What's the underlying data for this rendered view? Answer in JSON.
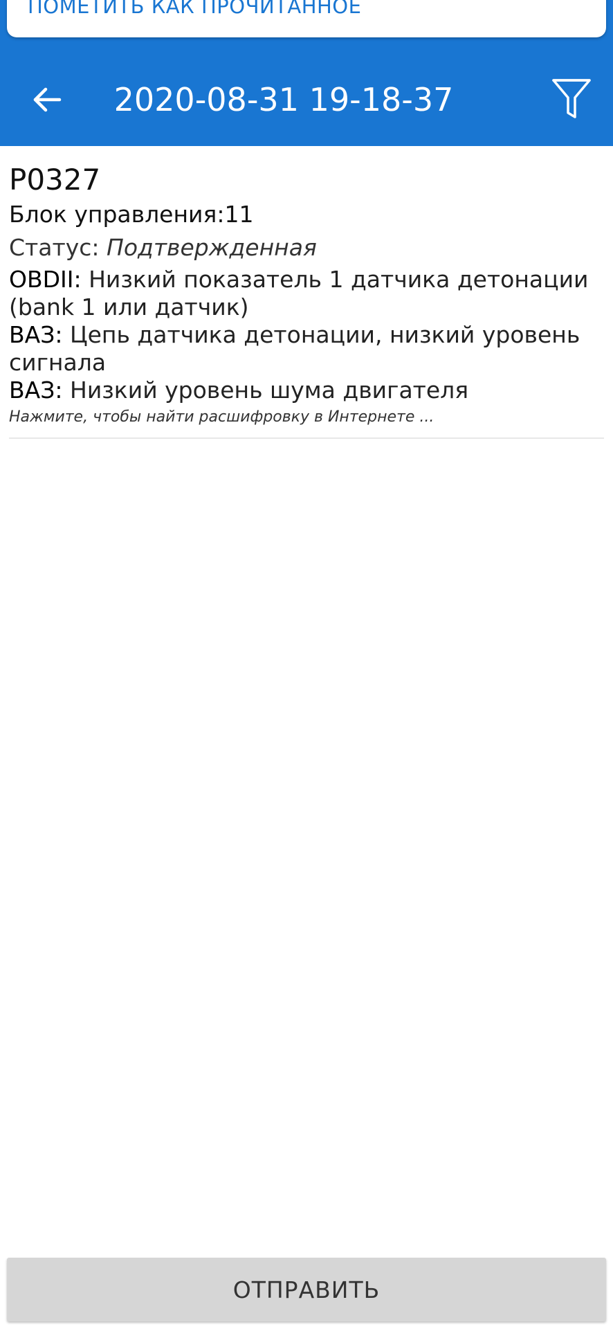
{
  "mark_read": {
    "label": "ПОМЕТИТЬ КАК ПРОЧИТАННОЕ"
  },
  "header": {
    "title": "2020-08-31 19-18-37",
    "back_icon": "arrow-left-icon",
    "filter_icon": "filter-icon",
    "background": "#1976d2"
  },
  "dtc": {
    "code": "P0327",
    "block": "Блок управления:11",
    "status_label": "Статус:",
    "status_value": "Подтвержденная",
    "descriptions": [
      {
        "label": "OBDII:",
        "text": "Низкий показатель 1 датчика детонации (bank 1 или датчик)"
      },
      {
        "label": "ВАЗ:",
        "text": "Цепь датчика детонации, низкий уровень сигнала"
      },
      {
        "label": "ВАЗ:",
        "text": "Низкий уровень шума двигателя"
      }
    ],
    "hint": "Нажмите, чтобы найти расшифровку в Интернете ..."
  },
  "footer": {
    "send_label": "ОТПРАВИТЬ"
  }
}
